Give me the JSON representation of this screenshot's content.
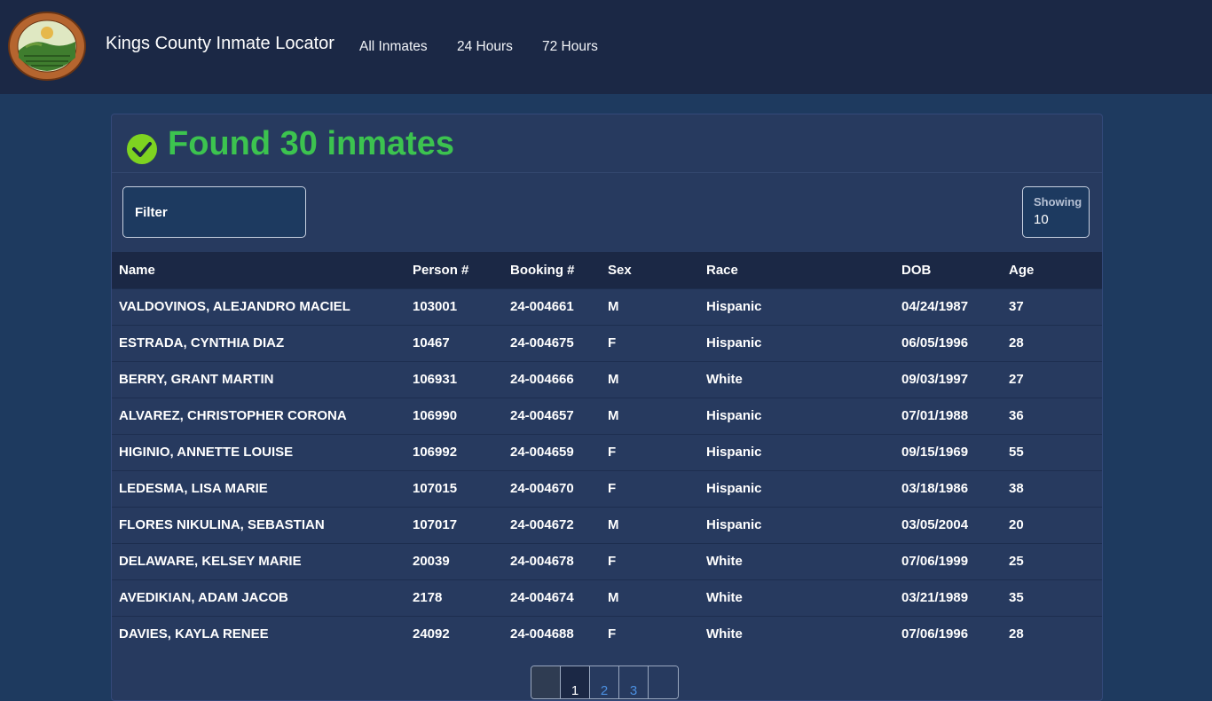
{
  "nav": {
    "brand": "Kings County Inmate Locator",
    "links": [
      "All Inmates",
      "24 Hours",
      "72 Hours"
    ],
    "seal_top_text": "COUNTY OF KINGS",
    "seal_bottom_text": "CALIFORNIA"
  },
  "result": {
    "title": "Found 30 inmates"
  },
  "filter": {
    "label": "Filter"
  },
  "showing": {
    "label": "Showing",
    "value": "10"
  },
  "table": {
    "headers": [
      "Name",
      "Person #",
      "Booking #",
      "Sex",
      "Race",
      "DOB",
      "Age"
    ],
    "rows": [
      [
        "VALDOVINOS, ALEJANDRO MACIEL",
        "103001",
        "24-004661",
        "M",
        "Hispanic",
        "04/24/1987",
        "37"
      ],
      [
        "ESTRADA, CYNTHIA DIAZ",
        "10467",
        "24-004675",
        "F",
        "Hispanic",
        "06/05/1996",
        "28"
      ],
      [
        "BERRY, GRANT MARTIN",
        "106931",
        "24-004666",
        "M",
        "White",
        "09/03/1997",
        "27"
      ],
      [
        "ALVAREZ, CHRISTOPHER CORONA",
        "106990",
        "24-004657",
        "M",
        "Hispanic",
        "07/01/1988",
        "36"
      ],
      [
        "HIGINIO, ANNETTE LOUISE",
        "106992",
        "24-004659",
        "F",
        "Hispanic",
        "09/15/1969",
        "55"
      ],
      [
        "LEDESMA, LISA MARIE",
        "107015",
        "24-004670",
        "F",
        "Hispanic",
        "03/18/1986",
        "38"
      ],
      [
        "FLORES NIKULINA, SEBASTIAN",
        "107017",
        "24-004672",
        "M",
        "Hispanic",
        "03/05/2004",
        "20"
      ],
      [
        "DELAWARE, KELSEY MARIE",
        "20039",
        "24-004678",
        "F",
        "White",
        "07/06/1999",
        "25"
      ],
      [
        "AVEDIKIAN, ADAM JACOB",
        "2178",
        "24-004674",
        "M",
        "White",
        "03/21/1989",
        "35"
      ],
      [
        "DAVIES, KAYLA RENEE",
        "24092",
        "24-004688",
        "F",
        "White",
        "07/06/1996",
        "28"
      ]
    ]
  },
  "pagination": {
    "pages": [
      "1",
      "2",
      "3"
    ]
  },
  "colors": {
    "accent_green": "#3cc34f",
    "navbar": "#1b2845",
    "background": "#1e3a5f"
  }
}
